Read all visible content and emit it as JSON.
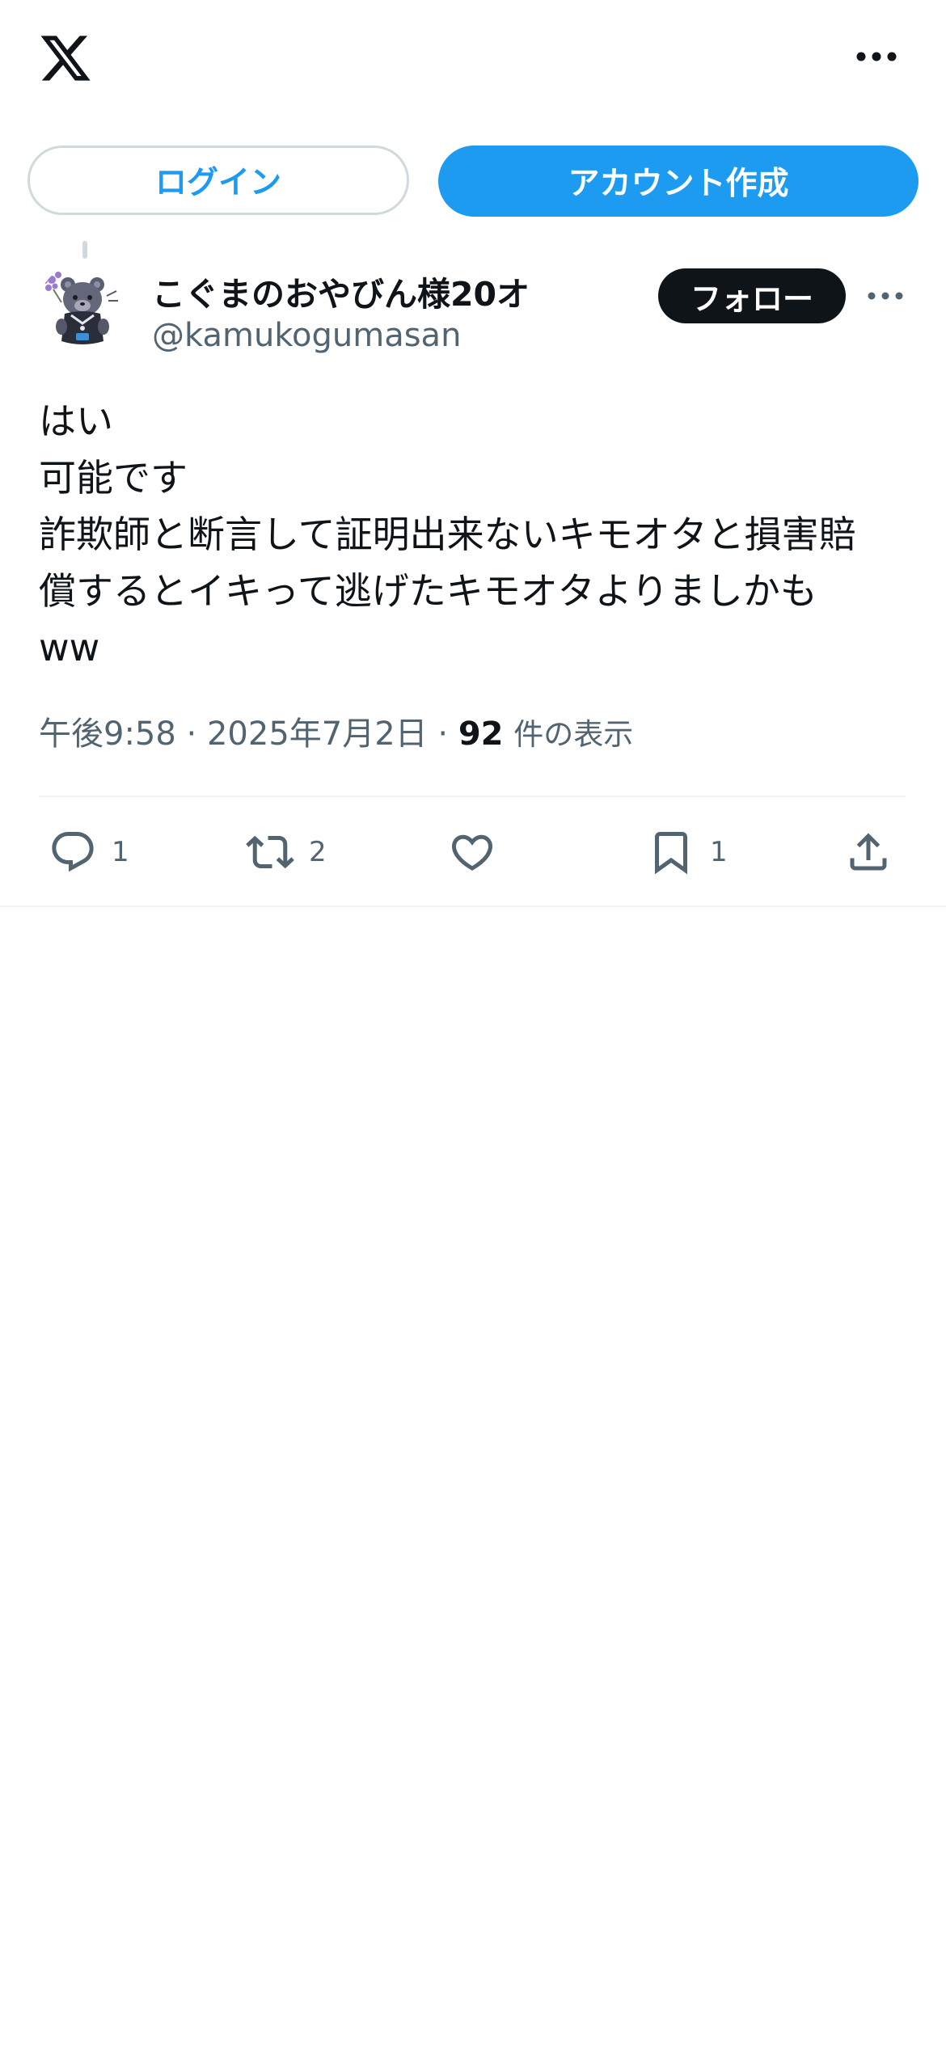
{
  "header": {
    "logo_icon": "x-logo-icon",
    "more_icon": "more-horizontal-icon"
  },
  "auth": {
    "login_label": "ログイン",
    "signup_label": "アカウント作成"
  },
  "post": {
    "author": {
      "display_name": "こぐまのおやびん様20オ",
      "handle": "@kamukogumasan",
      "avatar_icon": "bear-avatar"
    },
    "follow_label": "フォロー",
    "text_lines": [
      "はい",
      "可能です",
      "詐欺師と断言して証明出来ないキモオタと損害賠",
      "償するとイキって逃げたキモオタよりましかも",
      "ww"
    ],
    "meta": {
      "time": "午後9:58",
      "separator": "·",
      "date": "2025年7月2日",
      "views_count": "92",
      "views_label": "件の表示"
    },
    "actions": {
      "reply_count": "1",
      "repost_count": "2",
      "like_count": "",
      "bookmark_count": "1"
    }
  },
  "colors": {
    "accent": "#1d9bf0",
    "text_primary": "#0f1419",
    "text_secondary": "#536471",
    "border": "#cfd9de",
    "divider": "#eff3f4"
  }
}
